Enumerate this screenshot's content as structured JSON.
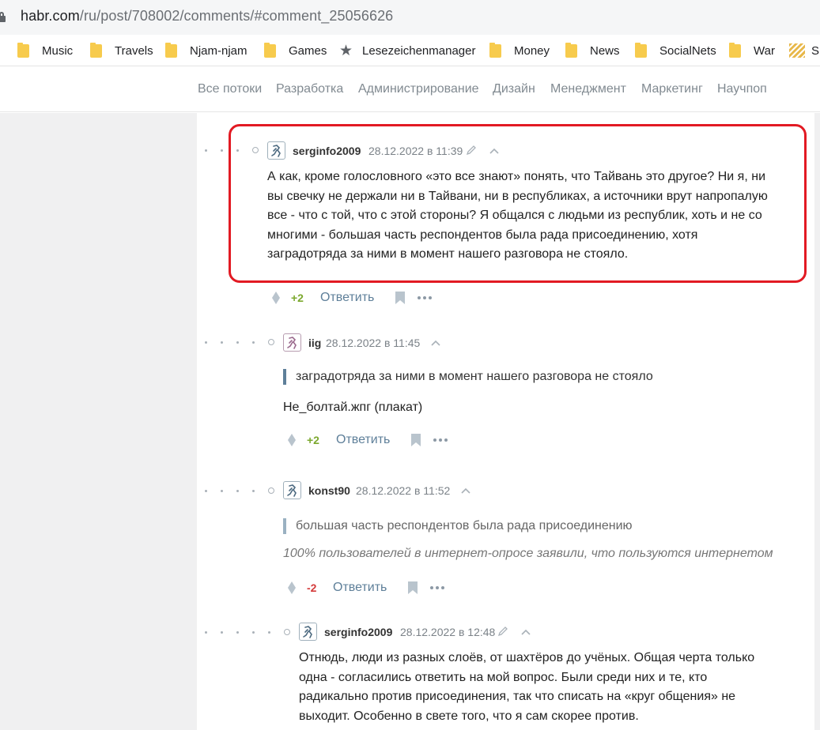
{
  "browser": {
    "url_host": "habr.com",
    "url_path": "/ru/post/708002/comments/#comment_25056626",
    "bookmarks": [
      {
        "label": "Music",
        "icon": "folder-icon"
      },
      {
        "label": "Travels",
        "icon": "folder-icon"
      },
      {
        "label": "Njam-njam",
        "icon": "folder-icon"
      },
      {
        "label": "Games",
        "icon": "folder-icon"
      },
      {
        "label": "Lesezeichenmanager",
        "icon": "star-icon"
      },
      {
        "label": "Money",
        "icon": "folder-icon"
      },
      {
        "label": "News",
        "icon": "folder-icon"
      },
      {
        "label": "SocialNets",
        "icon": "folder-icon"
      },
      {
        "label": "War",
        "icon": "folder-icon"
      },
      {
        "label": "S",
        "icon": "stripes-icon"
      }
    ]
  },
  "nav": {
    "links": [
      "Все потоки",
      "Разработка",
      "Администрирование",
      "Дизайн",
      "Менеджмент",
      "Маркетинг",
      "Научпоп"
    ]
  },
  "comments": [
    {
      "author": "serginfo2009",
      "date": "28.12.2022 в 11:39",
      "editable": true,
      "lines": [
        "А как, кроме голословного «это все знают» понять, что Тайвань это другое? Ни я, ни",
        "вы свечку не держали ни в Тайвани, ни в республиках, а источники врут напропалую",
        "все - что с той, что с этой стороны? Я общался с людьми из республик, хоть и не со",
        "многими - большая часть респондентов была рада присоединению, хотя",
        "заградотряда за ними в момент нашего разговора не стояло."
      ],
      "score": "+2",
      "reply_label": "Ответить"
    },
    {
      "author": "iig",
      "date": "28.12.2022 в 11:45",
      "quote": "заградотряда за ними в момент нашего разговора не стояло",
      "text": "Не_болтай.жпг (плакат)",
      "score": "+2",
      "reply_label": "Ответить"
    },
    {
      "author": "konst90",
      "date": "28.12.2022 в 11:52",
      "quote": "большая часть респондентов была рада присоединению",
      "text": "100% пользователей в интернет-опросе заявили, что пользуются интернетом",
      "score": "-2",
      "reply_label": "Ответить"
    },
    {
      "author": "serginfo2009",
      "date": "28.12.2022 в 12:48",
      "editable": true,
      "lines": [
        "Отнюдь, люди из разных слоёв, от шахтёров до учёных. Общая черта только",
        "одна - согласились ответить на мой вопрос. Были среди них и те, кто",
        "радикально против присоединения, так что списать на «круг общения» не",
        "выходит. Особенно в свете того, что я сам скорее против."
      ]
    }
  ],
  "colors": {
    "highlight_border": "#e21a23",
    "score_positive": "#7ba82d",
    "score_negative": "#d43a3a",
    "link": "#5e7f99"
  }
}
